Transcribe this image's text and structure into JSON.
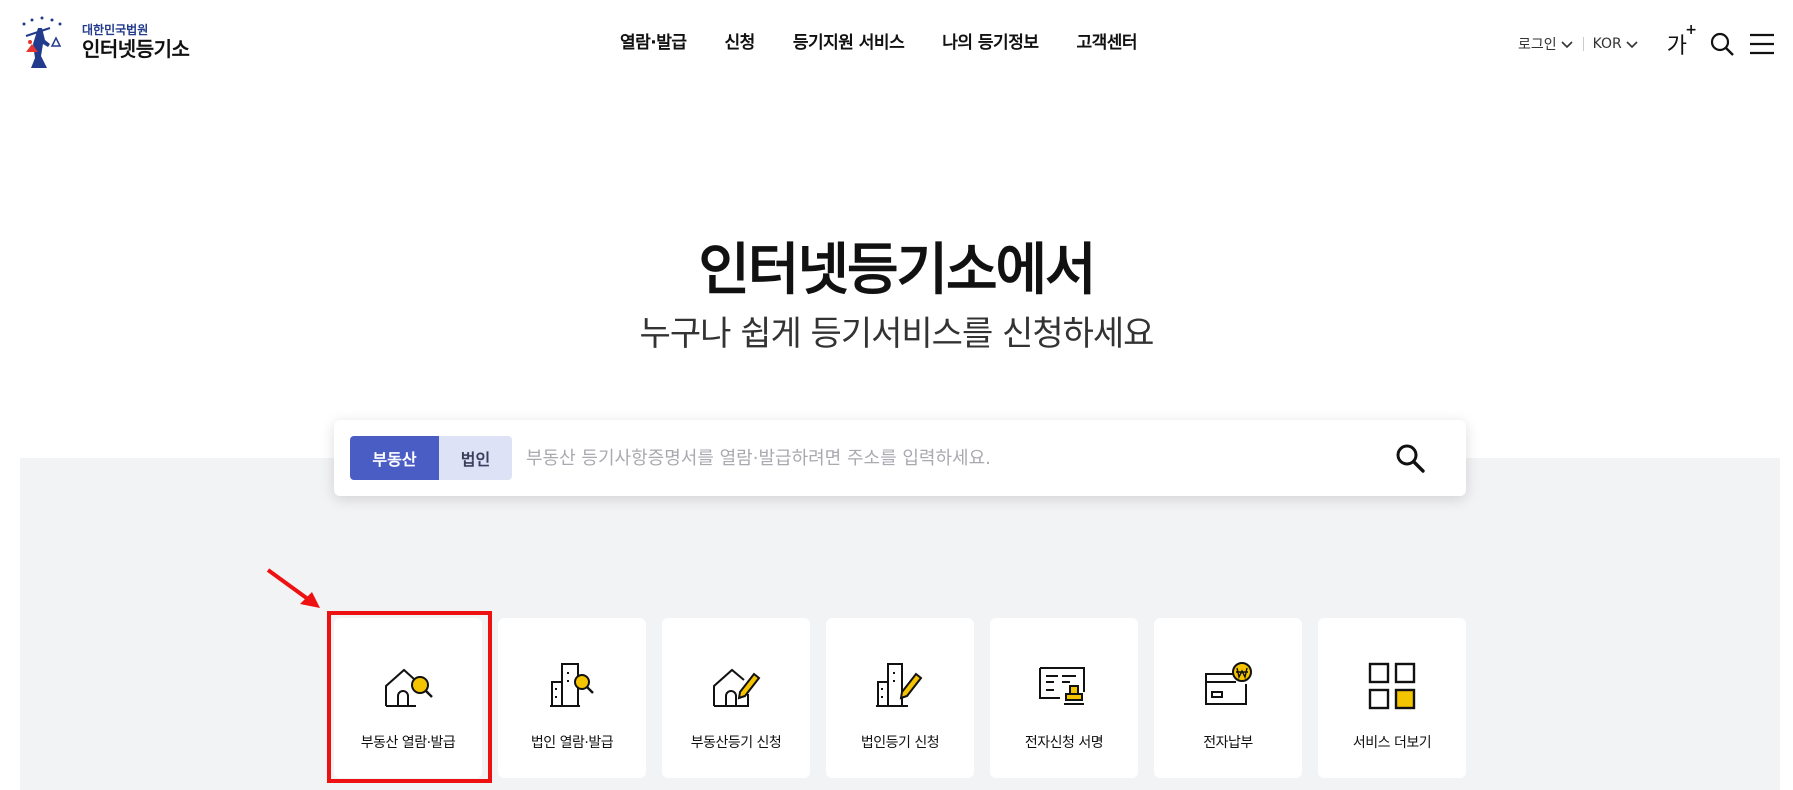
{
  "header": {
    "logo": {
      "sub": "대한민국법원",
      "main": "인터넷등기소"
    },
    "nav": [
      "열람·발급",
      "신청",
      "등기지원 서비스",
      "나의 등기정보",
      "고객센터"
    ],
    "utils": {
      "login": "로그인",
      "lang": "KOR",
      "font_size": "가",
      "font_plus": "+"
    }
  },
  "hero": {
    "title": "인터넷등기소에서",
    "subtitle": "누구나 쉽게 등기서비스를 신청하세요"
  },
  "search": {
    "tabs": [
      "부동산",
      "법인"
    ],
    "active_tab": "부동산",
    "placeholder": "부동산 등기사항증명서를 열람·발급하려면 주소를 입력하세요."
  },
  "services": [
    {
      "label": "부동산 열람·발급",
      "icon": "house-search-icon"
    },
    {
      "label": "법인 열람·발급",
      "icon": "building-search-icon"
    },
    {
      "label": "부동산등기 신청",
      "icon": "house-pen-icon"
    },
    {
      "label": "법인등기 신청",
      "icon": "building-pen-icon"
    },
    {
      "label": "전자신청 서명",
      "icon": "document-stamp-icon"
    },
    {
      "label": "전자납부",
      "icon": "card-won-icon"
    },
    {
      "label": "서비스 더보기",
      "icon": "grid-more-icon"
    }
  ],
  "colors": {
    "primary": "#4a5dc4",
    "accent": "#f5c400",
    "band": "#f2f3f5",
    "annotation": "#ee1111"
  }
}
